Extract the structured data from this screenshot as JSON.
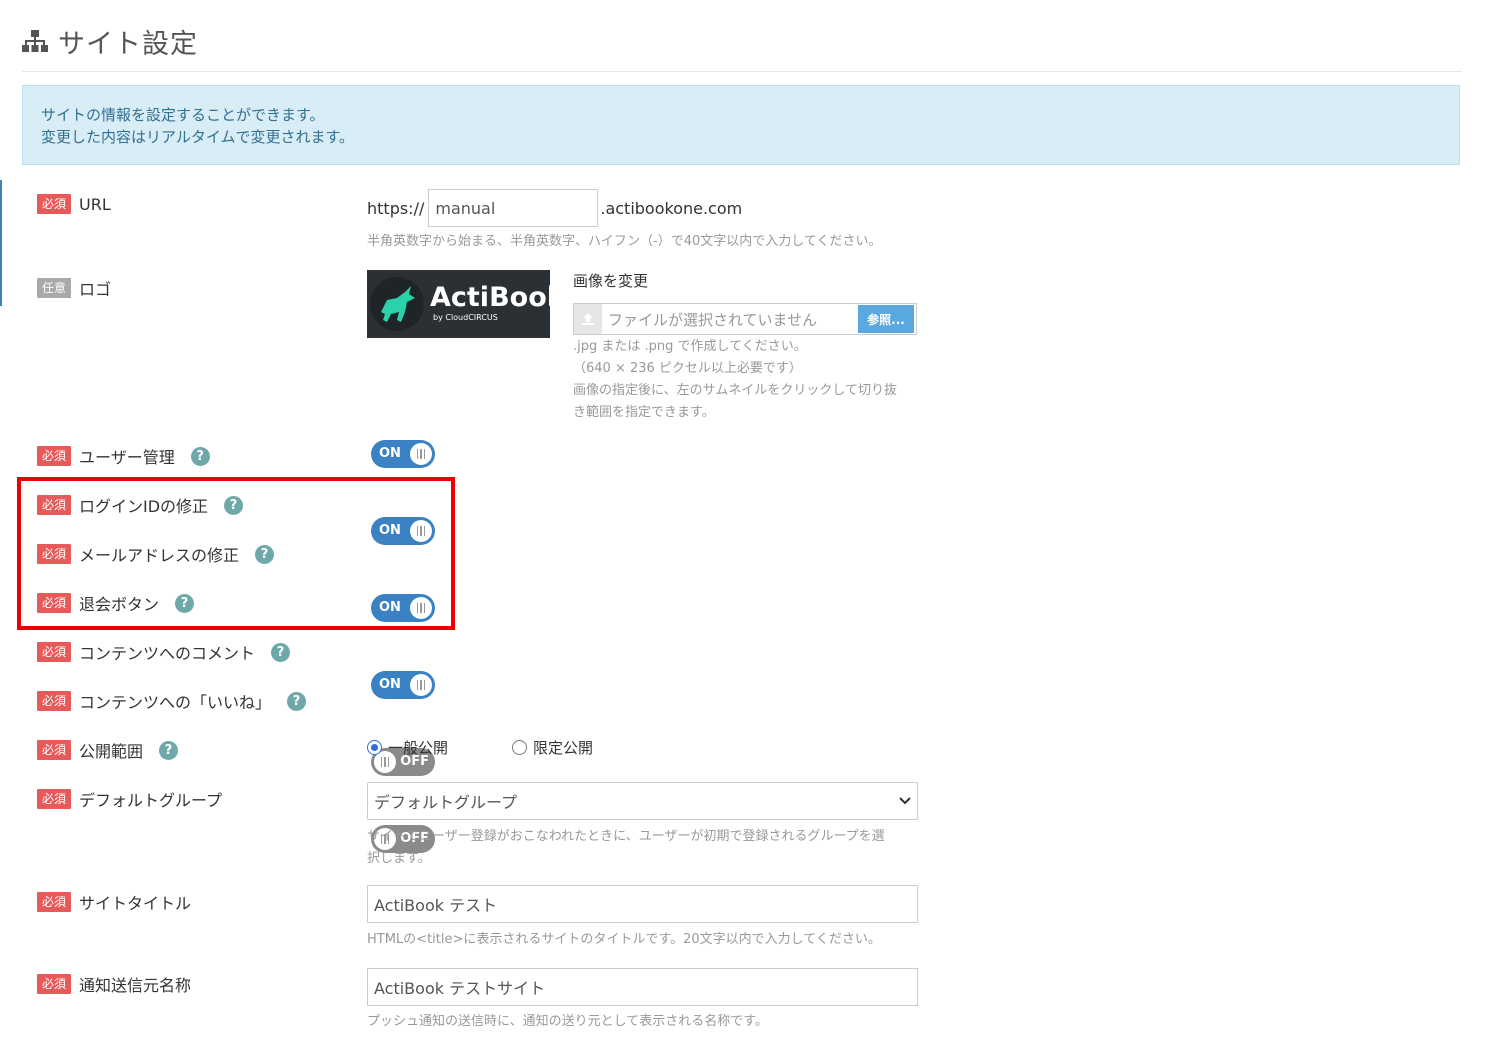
{
  "page": {
    "title": "サイト設定",
    "info_line1": "サイトの情報を設定することができます。",
    "info_line2": "変更した内容はリアルタイムで変更されます。"
  },
  "badges": {
    "required": "必須",
    "optional": "任意"
  },
  "url": {
    "label": "URL",
    "prefix": "https://",
    "value": "manual",
    "suffix": ".actibookone.com",
    "hint": "半角英数字から始まる、半角英数字、ハイフン（-）で40文字以内で入力してください。"
  },
  "logo": {
    "label": "ロゴ",
    "image_text": "ActiBook",
    "image_sub": "by CloudCIRCUS",
    "change_label": "画像を変更",
    "file_placeholder": "ファイルが選択されていません",
    "browse_button": "参照...",
    "hint1": ".jpg または .png で作成してください。",
    "hint2": "（640 × 236 ピクセル以上必要です）",
    "hint3": "画像の指定後に、左のサムネイルをクリックして切り抜",
    "hint4": "き範囲を指定できます。"
  },
  "toggles": {
    "user_management": {
      "label": "ユーザー管理",
      "state": "ON"
    },
    "login_id_edit": {
      "label": "ログインIDの修正",
      "state": "ON"
    },
    "email_edit": {
      "label": "メールアドレスの修正",
      "state": "ON"
    },
    "withdraw_button": {
      "label": "退会ボタン",
      "state": "ON"
    },
    "content_comment": {
      "label": "コンテンツへのコメント",
      "state": "OFF"
    },
    "content_like": {
      "label": "コンテンツへの「いいね」",
      "state": "OFF"
    }
  },
  "visibility": {
    "label": "公開範囲",
    "option_public": "一般公開",
    "option_limited": "限定公開",
    "selected": "一般公開"
  },
  "default_group": {
    "label": "デフォルトグループ",
    "selected": "デフォルトグループ",
    "hint1": "サイトでユーザー登録がおこなわれたときに、ユーザーが初期で登録されるグループを選",
    "hint2": "択します。"
  },
  "site_title": {
    "label": "サイトタイトル",
    "value": "ActiBook テスト",
    "hint": "HTMLの<title>に表示されるサイトのタイトルです。20文字以内で入力してください。"
  },
  "sender_name": {
    "label": "通知送信元名称",
    "value": "ActiBook テストサイト",
    "hint": "プッシュ通知の送信時に、通知の送り元として表示される名称です。"
  },
  "colors": {
    "accent": "#3b82c4",
    "required": "#e75a5a",
    "highlight": "#ee0000",
    "info_bg": "#d9edf7"
  }
}
